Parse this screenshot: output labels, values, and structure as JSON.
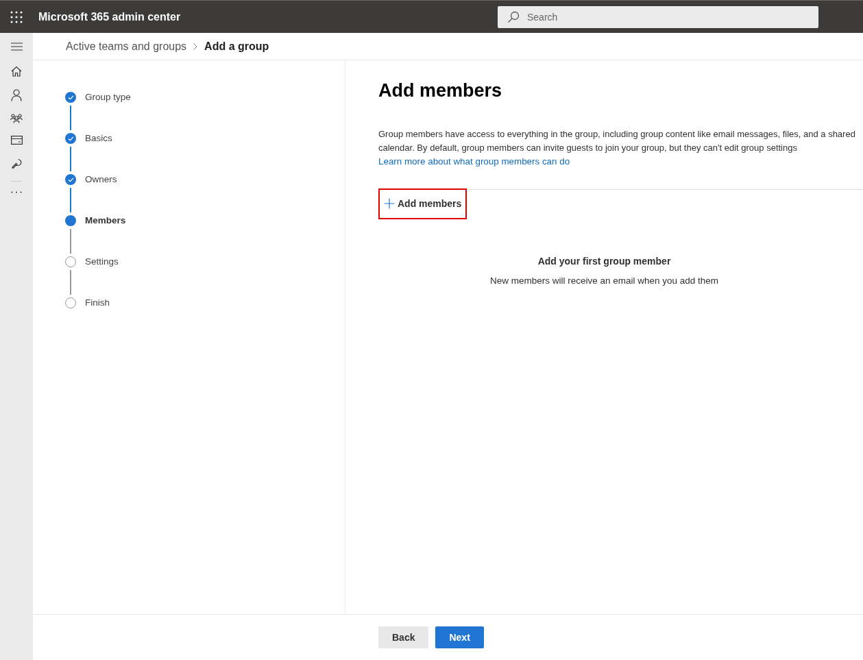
{
  "app_bar": {
    "title": "Microsoft 365 admin center",
    "search": {
      "placeholder": "Search"
    }
  },
  "breadcrumb": [
    {
      "label": "Active teams and groups",
      "current": false
    },
    {
      "label": "Add a group",
      "current": true
    }
  ],
  "steps": [
    {
      "label": "Group type",
      "completed": true,
      "current": false
    },
    {
      "label": "Basics",
      "completed": true,
      "current": false
    },
    {
      "label": "Owners",
      "completed": true,
      "current": false
    },
    {
      "label": "Members",
      "completed": false,
      "current": true
    },
    {
      "label": "Settings",
      "completed": false,
      "current": false
    },
    {
      "label": "Finish",
      "completed": false,
      "current": false
    }
  ],
  "content": {
    "heading": "Add members",
    "description": "Group members have access to everything in the group, including group content like email messages, files, and a shared calendar. By default, group members can invite guests to join your group, but they can't edit group settings",
    "learn_more_link": "Learn more about what group members can do",
    "add_button": {
      "label": "Add members",
      "highlighted": true
    },
    "empty_title": "Add your first group member",
    "empty_text": "New members will receive an email when you add them"
  },
  "footer": {
    "buttons": [
      {
        "label": "Back",
        "kind": "secondary"
      },
      {
        "label": "Next",
        "kind": "primary"
      }
    ]
  }
}
